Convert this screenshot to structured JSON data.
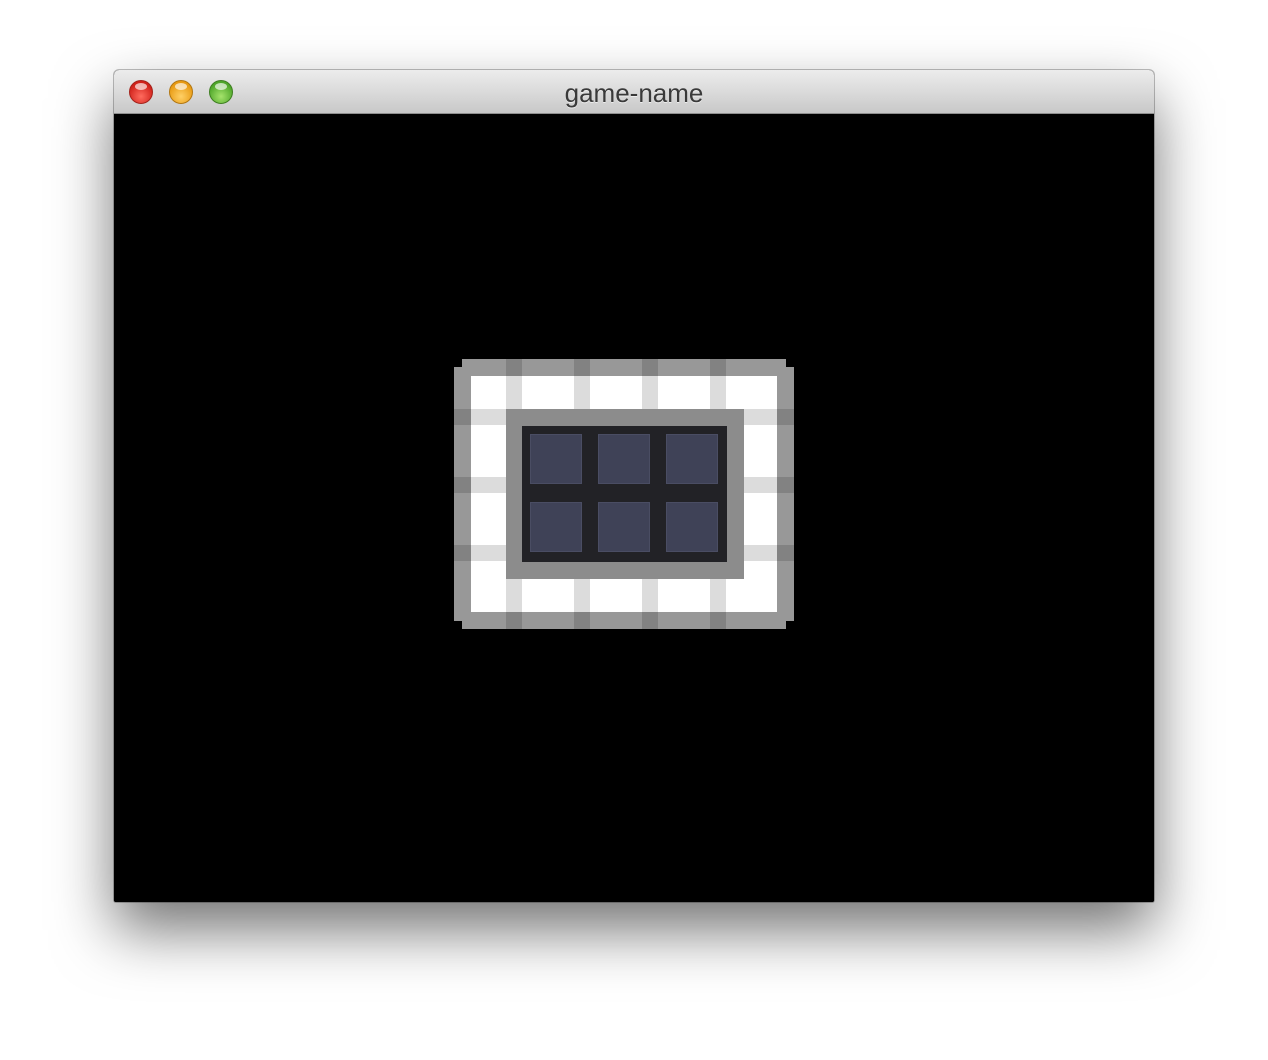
{
  "window": {
    "title": "game-name",
    "controls": [
      "close-icon",
      "minimize-icon",
      "maximize-icon"
    ],
    "colors": {
      "background": "#000000",
      "close": "#d0211a",
      "minimize": "#e89a12",
      "maximize": "#4ea629"
    }
  },
  "game": {
    "inventory": {
      "rows": 2,
      "columns": 3,
      "slots": [
        {
          "id": "slot-1",
          "empty": true
        },
        {
          "id": "slot-2",
          "empty": true
        },
        {
          "id": "slot-3",
          "empty": true
        },
        {
          "id": "slot-4",
          "empty": true
        },
        {
          "id": "slot-5",
          "empty": true
        },
        {
          "id": "slot-6",
          "empty": true
        }
      ],
      "colors": {
        "panel": "#ffffff",
        "frame": "#989898",
        "slot": "#3f4257",
        "slot_gap": "#222226"
      }
    }
  }
}
